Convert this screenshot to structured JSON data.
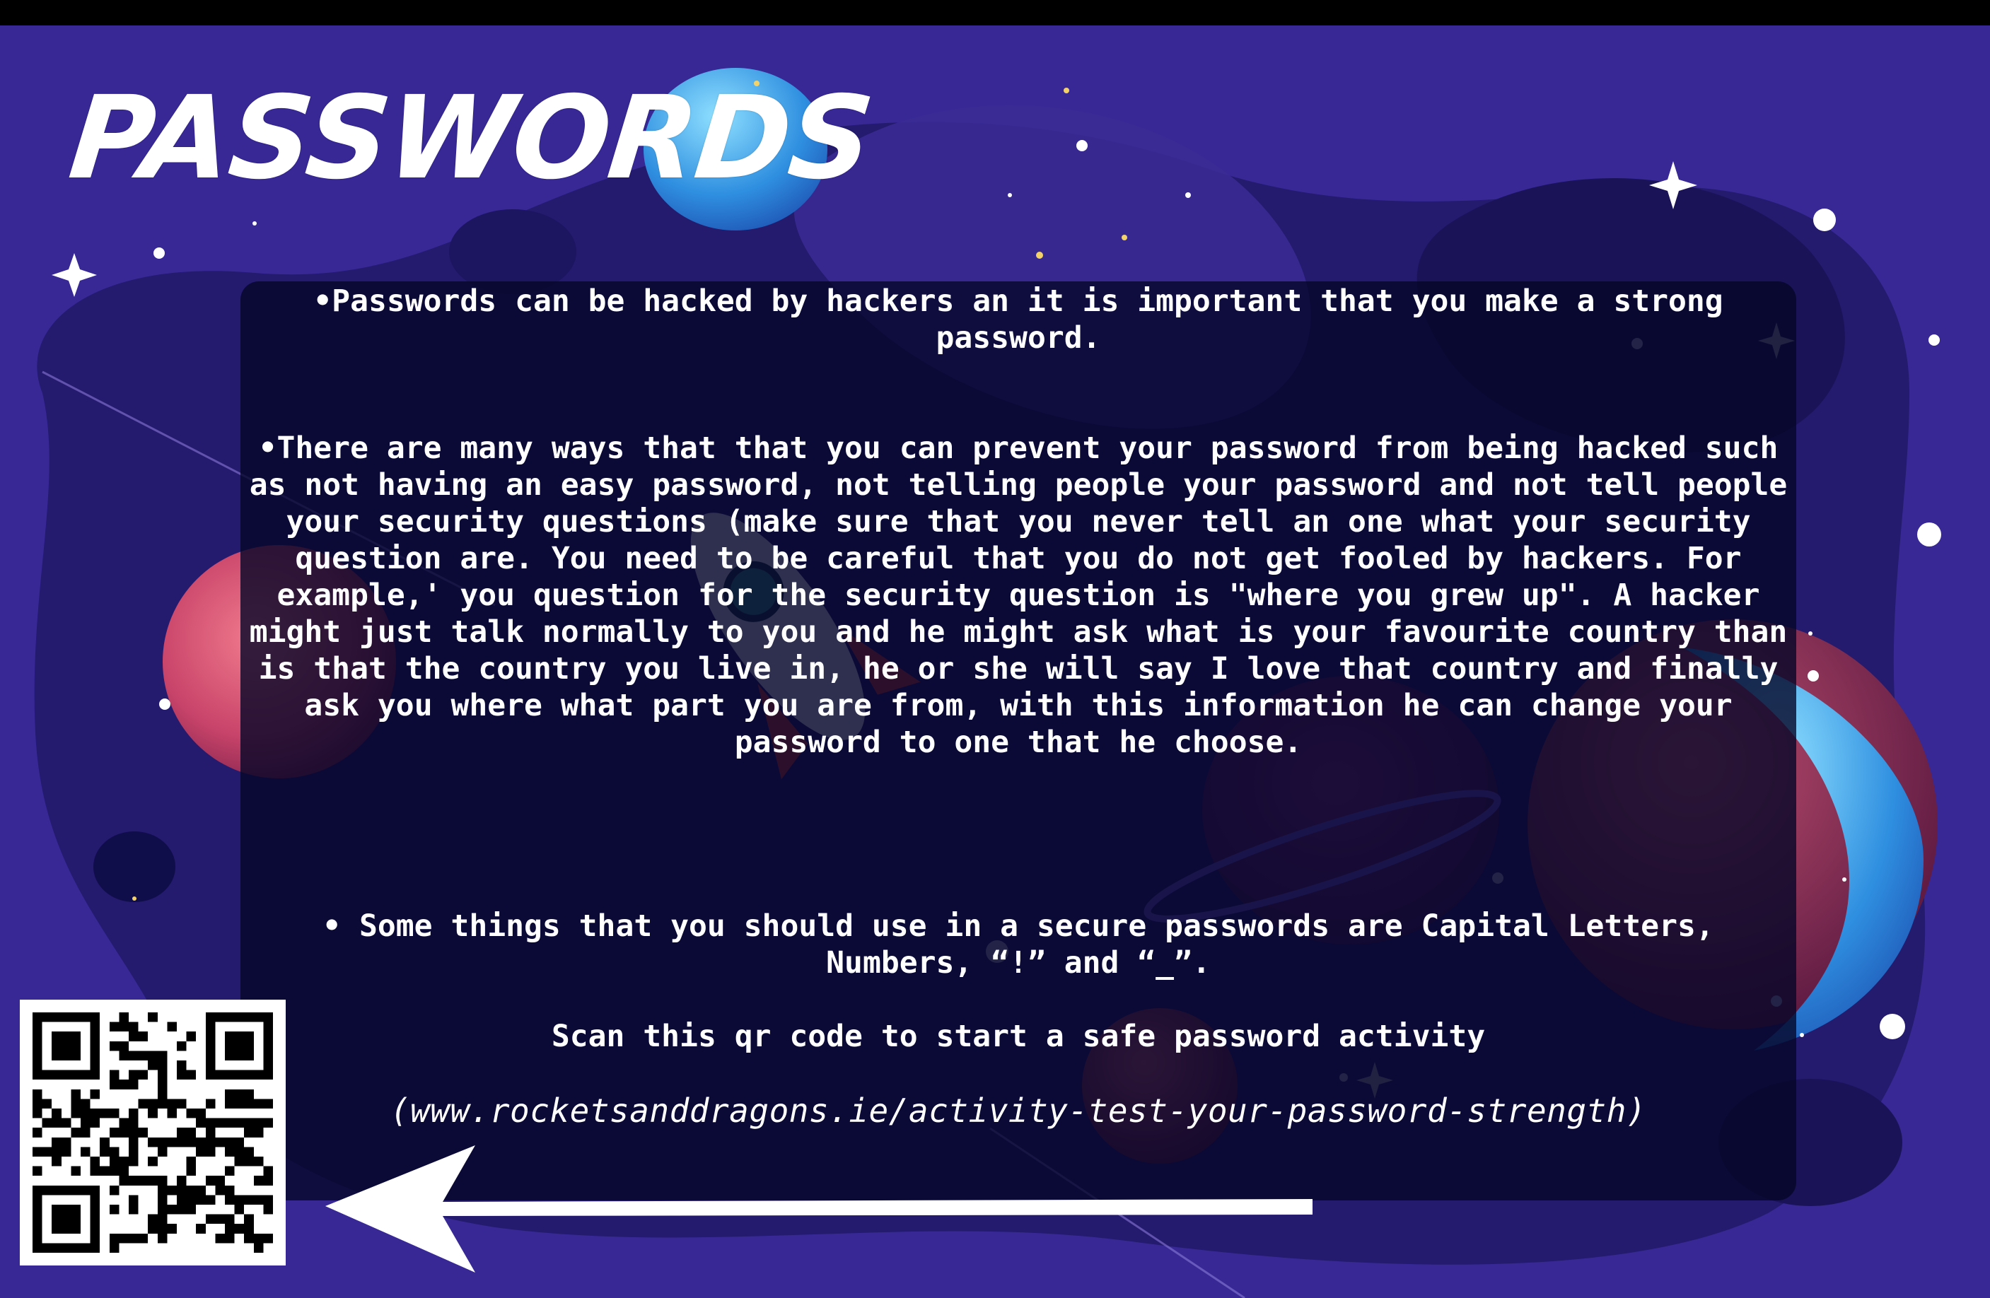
{
  "page": {
    "title": "PASSWORDS",
    "paragraphs": [
      "•Passwords can be hacked by hackers an it is important that you make a strong password.",
      "•There are many ways that that you can prevent your password from being hacked such as not having an easy password, not telling people your password and not tell people your security questions (make sure that you never tell an one what your security question are. You need to be careful that you do not get fooled by hackers. For example,' you question for the security question is \"where you grew up\". A hacker might just talk normally to you and he might ask what is your favourite country than is that the country you live in, he or she will say I love that country and finally ask you where what part you are from, with this information he can change your password to one that he choose.",
      "• Some things that you should use in a secure passwords are  Capital Letters, Numbers, “!” and “_”."
    ],
    "scan_prompt": "Scan this qr code to start a safe password activity",
    "url": "(www.rocketsanddragons.ie/activity-test-your-password-strength)"
  },
  "graphics": {
    "qr_code": "qr-code",
    "arrow": "arrow-left-icon",
    "background": "space-scene"
  },
  "colors": {
    "background": "#372896",
    "panel": "#05062A",
    "text": "#FFFFFF"
  }
}
